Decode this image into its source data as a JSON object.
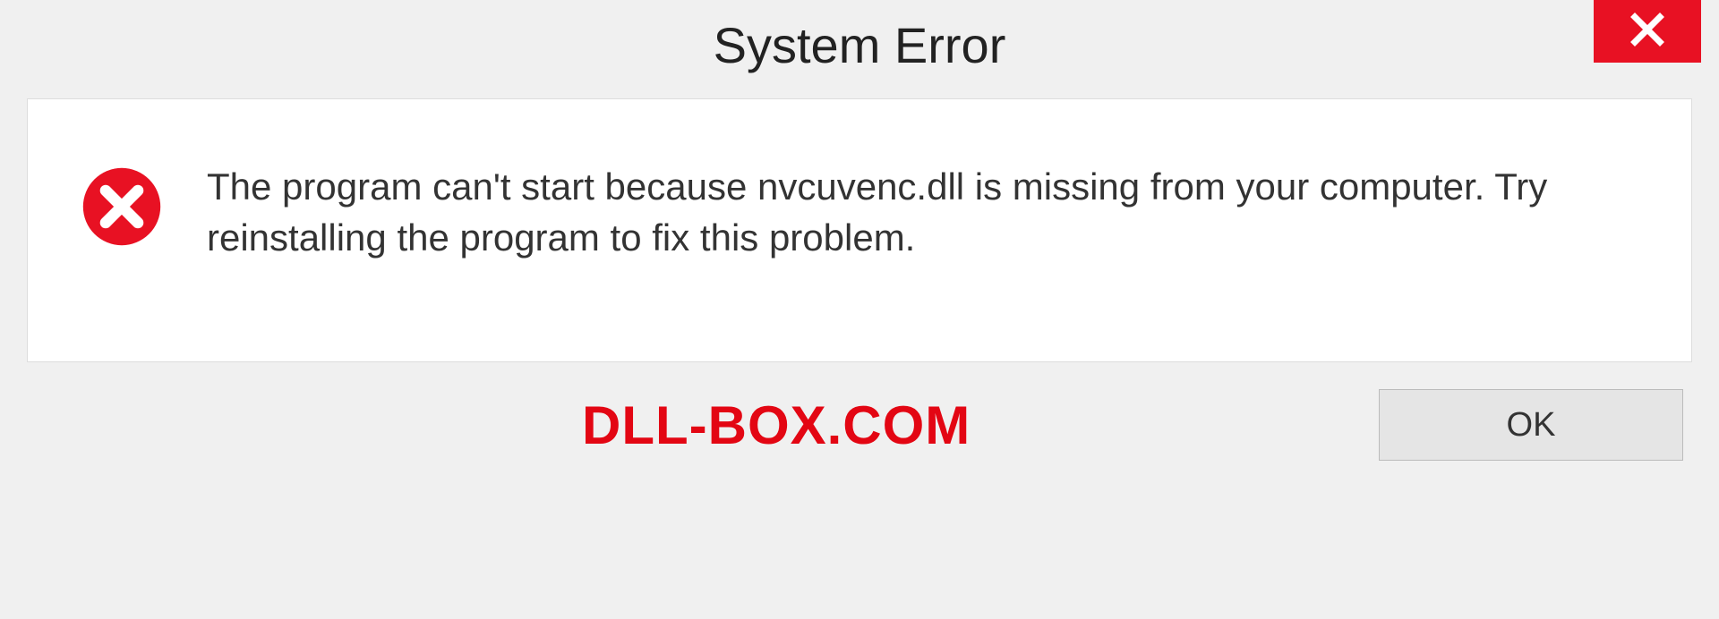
{
  "dialog": {
    "title": "System Error",
    "message": "The program can't start because nvcuvenc.dll is missing from your computer. Try reinstalling the program to fix this problem.",
    "ok_label": "OK"
  },
  "watermark": "DLL-BOX.COM"
}
